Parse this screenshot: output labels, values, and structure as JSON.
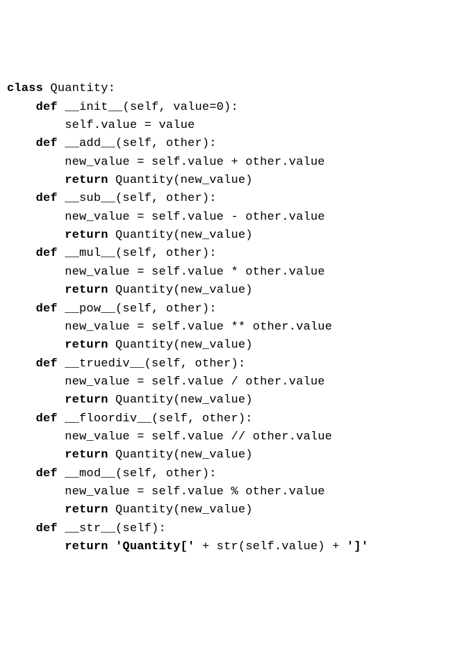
{
  "code": {
    "lines": [
      {
        "indent": 0,
        "segments": [
          {
            "t": "class ",
            "kw": true
          },
          {
            "t": "Quantity:",
            "kw": false
          }
        ]
      },
      {
        "indent": 1,
        "segments": [
          {
            "t": "def ",
            "kw": true
          },
          {
            "t": "__init__(self, value=0):",
            "kw": false
          }
        ]
      },
      {
        "indent": 2,
        "segments": [
          {
            "t": "self.value = value",
            "kw": false
          }
        ]
      },
      {
        "indent": 0,
        "segments": [
          {
            "t": "",
            "kw": false
          }
        ]
      },
      {
        "indent": 1,
        "segments": [
          {
            "t": "def ",
            "kw": true
          },
          {
            "t": "__add__(self, other):",
            "kw": false
          }
        ]
      },
      {
        "indent": 2,
        "segments": [
          {
            "t": "new_value = self.value + other.value",
            "kw": false
          }
        ]
      },
      {
        "indent": 2,
        "segments": [
          {
            "t": "return ",
            "kw": true
          },
          {
            "t": "Quantity(new_value)",
            "kw": false
          }
        ]
      },
      {
        "indent": 0,
        "segments": [
          {
            "t": "",
            "kw": false
          }
        ]
      },
      {
        "indent": 1,
        "segments": [
          {
            "t": "def ",
            "kw": true
          },
          {
            "t": "__sub__(self, other):",
            "kw": false
          }
        ]
      },
      {
        "indent": 2,
        "segments": [
          {
            "t": "new_value = self.value - other.value",
            "kw": false
          }
        ]
      },
      {
        "indent": 2,
        "segments": [
          {
            "t": "return ",
            "kw": true
          },
          {
            "t": "Quantity(new_value)",
            "kw": false
          }
        ]
      },
      {
        "indent": 0,
        "segments": [
          {
            "t": "",
            "kw": false
          }
        ]
      },
      {
        "indent": 1,
        "segments": [
          {
            "t": "def ",
            "kw": true
          },
          {
            "t": "__mul__(self, other):",
            "kw": false
          }
        ]
      },
      {
        "indent": 2,
        "segments": [
          {
            "t": "new_value = self.value * other.value",
            "kw": false
          }
        ]
      },
      {
        "indent": 2,
        "segments": [
          {
            "t": "return ",
            "kw": true
          },
          {
            "t": "Quantity(new_value)",
            "kw": false
          }
        ]
      },
      {
        "indent": 0,
        "segments": [
          {
            "t": "",
            "kw": false
          }
        ]
      },
      {
        "indent": 1,
        "segments": [
          {
            "t": "def ",
            "kw": true
          },
          {
            "t": "__pow__(self, other):",
            "kw": false
          }
        ]
      },
      {
        "indent": 2,
        "segments": [
          {
            "t": "new_value = self.value ** other.value",
            "kw": false
          }
        ]
      },
      {
        "indent": 2,
        "segments": [
          {
            "t": "return ",
            "kw": true
          },
          {
            "t": "Quantity(new_value)",
            "kw": false
          }
        ]
      },
      {
        "indent": 0,
        "segments": [
          {
            "t": "",
            "kw": false
          }
        ]
      },
      {
        "indent": 1,
        "segments": [
          {
            "t": "def ",
            "kw": true
          },
          {
            "t": "__truediv__(self, other):",
            "kw": false
          }
        ]
      },
      {
        "indent": 2,
        "segments": [
          {
            "t": "new_value = self.value / other.value",
            "kw": false
          }
        ]
      },
      {
        "indent": 2,
        "segments": [
          {
            "t": "return ",
            "kw": true
          },
          {
            "t": "Quantity(new_value)",
            "kw": false
          }
        ]
      },
      {
        "indent": 0,
        "segments": [
          {
            "t": "",
            "kw": false
          }
        ]
      },
      {
        "indent": 1,
        "segments": [
          {
            "t": "def ",
            "kw": true
          },
          {
            "t": "__floordiv__(self, other):",
            "kw": false
          }
        ]
      },
      {
        "indent": 2,
        "segments": [
          {
            "t": "new_value = self.value // other.value",
            "kw": false
          }
        ]
      },
      {
        "indent": 2,
        "segments": [
          {
            "t": "return ",
            "kw": true
          },
          {
            "t": "Quantity(new_value)",
            "kw": false
          }
        ]
      },
      {
        "indent": 0,
        "segments": [
          {
            "t": "",
            "kw": false
          }
        ]
      },
      {
        "indent": 1,
        "segments": [
          {
            "t": "def ",
            "kw": true
          },
          {
            "t": "__mod__(self, other):",
            "kw": false
          }
        ]
      },
      {
        "indent": 2,
        "segments": [
          {
            "t": "new_value = self.value % other.value",
            "kw": false
          }
        ]
      },
      {
        "indent": 2,
        "segments": [
          {
            "t": "return ",
            "kw": true
          },
          {
            "t": "Quantity(new_value)",
            "kw": false
          }
        ]
      },
      {
        "indent": 0,
        "segments": [
          {
            "t": "",
            "kw": false
          }
        ]
      },
      {
        "indent": 1,
        "segments": [
          {
            "t": "def ",
            "kw": true
          },
          {
            "t": "__str__(self):",
            "kw": false
          }
        ]
      },
      {
        "indent": 2,
        "segments": [
          {
            "t": "return 'Quantity[' ",
            "kw": true
          },
          {
            "t": "+ str(self.value) + ",
            "kw": false
          },
          {
            "t": "']'",
            "kw": true
          }
        ]
      }
    ],
    "indent_unit": "    "
  }
}
